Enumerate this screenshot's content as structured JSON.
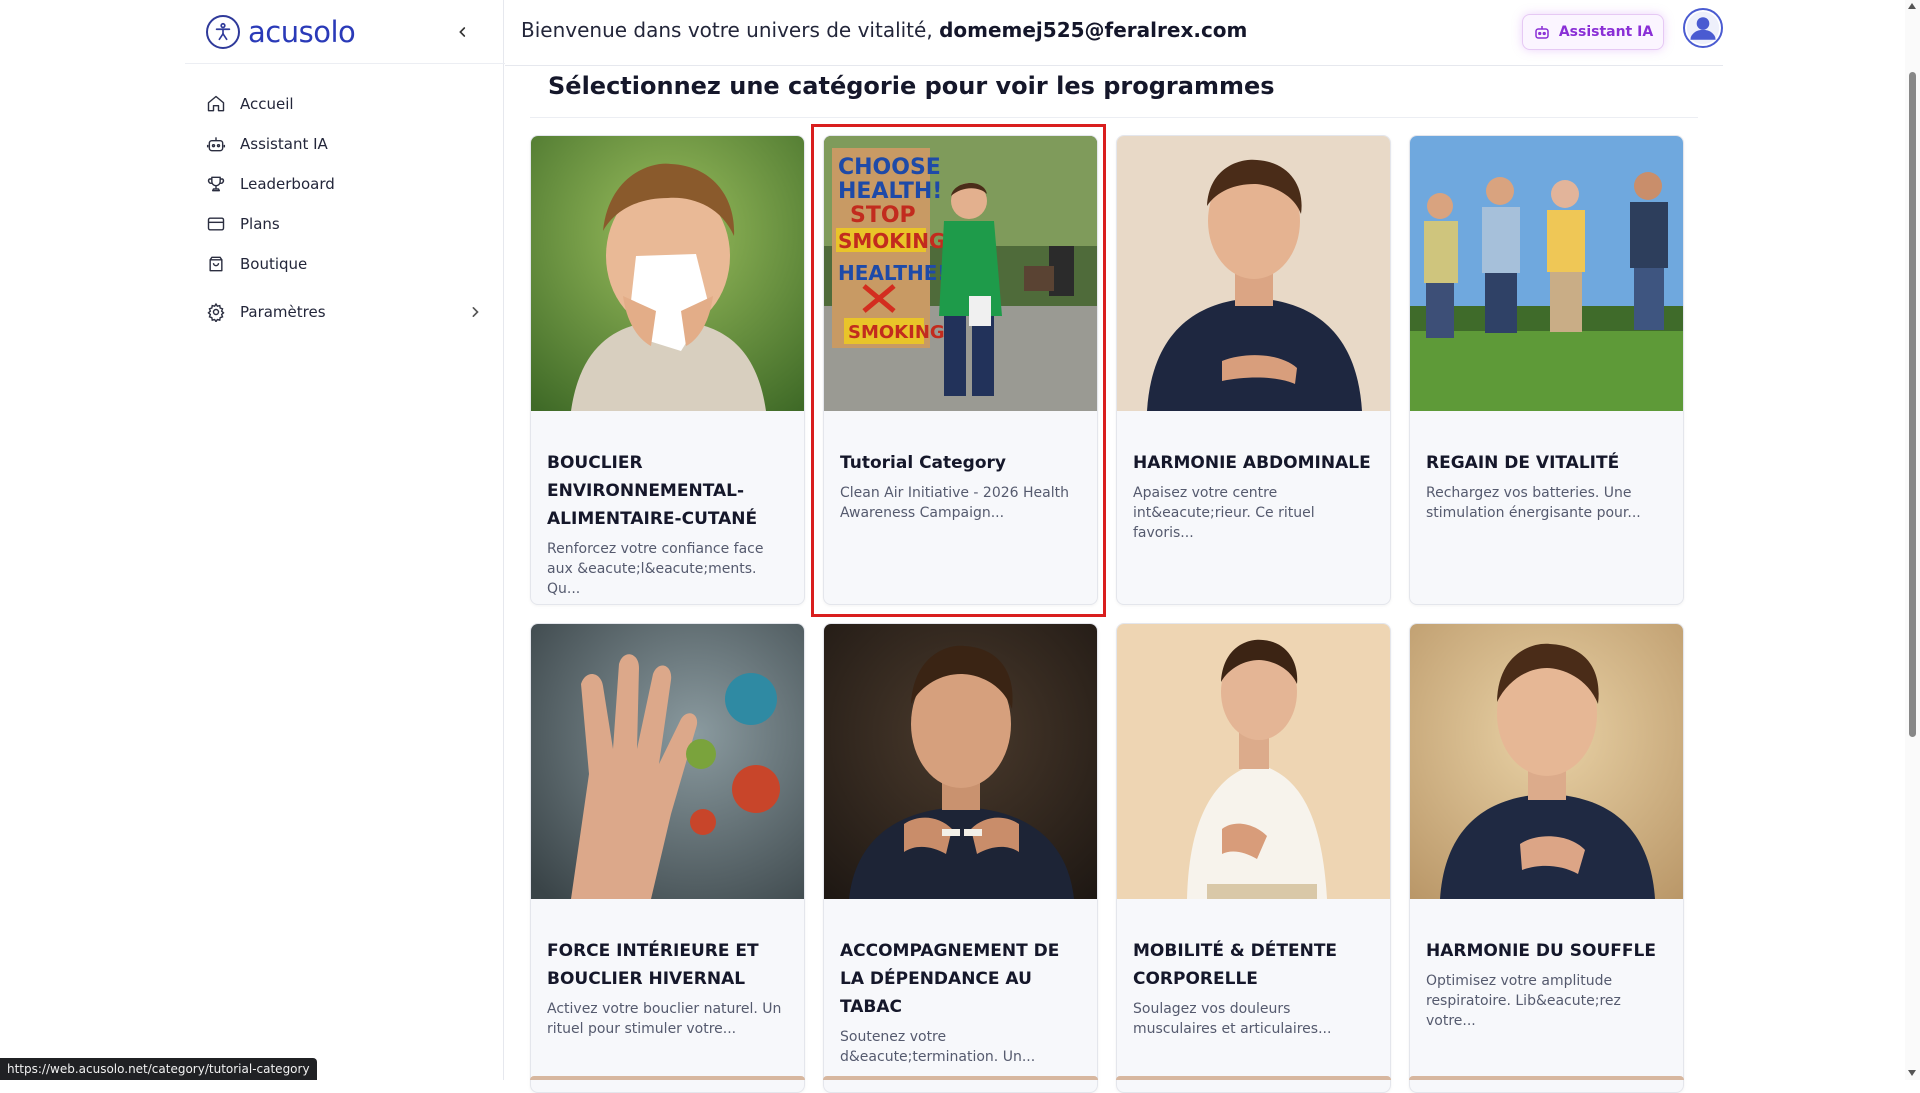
{
  "brand": {
    "name": "acusolo"
  },
  "sidebar": {
    "items": [
      {
        "label": "Accueil",
        "icon": "home-icon"
      },
      {
        "label": "Assistant IA",
        "icon": "robot-icon"
      },
      {
        "label": "Leaderboard",
        "icon": "trophy-icon"
      },
      {
        "label": "Plans",
        "icon": "card-icon"
      },
      {
        "label": "Boutique",
        "icon": "bag-icon"
      }
    ],
    "settings": {
      "label": "Paramètres",
      "icon": "gear-icon"
    }
  },
  "header": {
    "welcome": "Bienvenue dans votre univers de vitalité,",
    "email": "domemej525@feralrex.com",
    "ai_button": "Assistant IA"
  },
  "main": {
    "title": "Sélectionnez une catégorie pour voir les programmes",
    "cards": [
      {
        "title": "BOUCLIER ENVIRONNEMENTAL-ALIMENTAIRE-CUTANÉ",
        "desc": "Renforcez votre confiance face aux &eacute;l&eacute;ments. Qu...",
        "image": "child-sneezing"
      },
      {
        "title": "Tutorial Category",
        "desc": "Clean Air Initiative - 2026 Health Awareness Campaign...",
        "image": "anti-smoking-sign"
      },
      {
        "title": "HARMONIE ABDOMINALE",
        "desc": "Apaisez votre centre int&eacute;rieur. Ce rituel favoris...",
        "image": "man-hand-on-belly"
      },
      {
        "title": "REGAIN DE VITALITÉ",
        "desc": "Rechargez vos batteries. Une stimulation énergisante pour...",
        "image": "people-jumping"
      },
      {
        "title": "FORCE INTÉRIEURE ET BOUCLIER HIVERNAL",
        "desc": "Activez votre bouclier naturel. Un rituel pour stimuler votre...",
        "image": "hand-blocking-viruses"
      },
      {
        "title": "ACCOMPAGNEMENT DE LA DÉPENDANCE AU TABAC",
        "desc": "Soutenez votre d&eacute;termination. Un...",
        "image": "man-breaking-cigarette"
      },
      {
        "title": "MOBILITÉ & DÉTENTE CORPORELLE",
        "desc": "Soulagez vos douleurs musculaires et articulaires...",
        "image": "man-back-pain"
      },
      {
        "title": "HARMONIE DU SOUFFLE",
        "desc": "Optimisez votre amplitude respiratoire. Lib&eacute;rez votre...",
        "image": "teen-hand-on-chest"
      }
    ],
    "selected_card": "Tutorial Category"
  },
  "poster": {
    "lines": [
      "CHOOSE",
      "HEALTH!",
      "STOP",
      "SMOKING!",
      "HEALTHE!",
      "SMOKING!"
    ]
  },
  "status_bar": {
    "url": "https://web.acusolo.net/category/tutorial-category"
  },
  "colors": {
    "brand": "#2a3ab8",
    "ai_accent": "#8a2fd6",
    "highlight": "#d91e1e"
  }
}
